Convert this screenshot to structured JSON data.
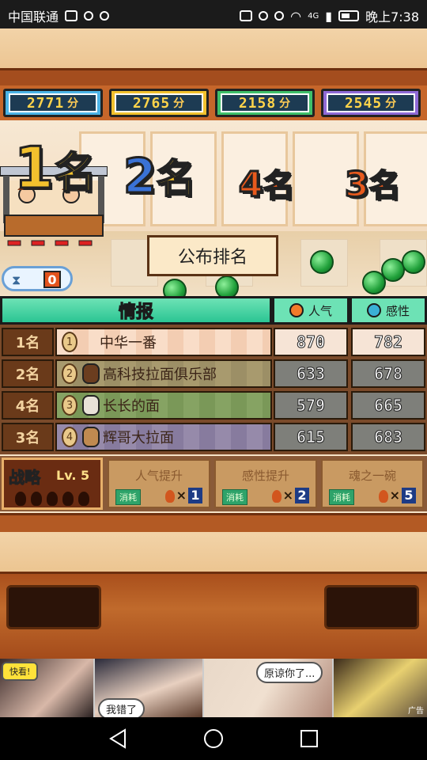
{
  "status_bar": {
    "carrier": "中国联通",
    "time": "晚上7:38",
    "network": "4G"
  },
  "scores": [
    {
      "value": "2771",
      "unit": "分",
      "color": "#4bb3e6"
    },
    {
      "value": "2765",
      "unit": "分",
      "color": "#f2c12e"
    },
    {
      "value": "2158",
      "unit": "分",
      "color": "#3fc06a"
    },
    {
      "value": "2545",
      "unit": "分",
      "color": "#8f6ad6"
    }
  ],
  "ranks": [
    {
      "num": "1",
      "kanji": "名",
      "color": "#f2c12e"
    },
    {
      "num": "2",
      "kanji": "名",
      "color": "#3a72d6"
    },
    {
      "num": "4",
      "kanji": "名",
      "color": "#e85a1d"
    },
    {
      "num": "3",
      "kanji": "名",
      "color": "#e85a1d"
    }
  ],
  "announce_button": "公布排名",
  "timer_value": "0",
  "info_table": {
    "title": "情报",
    "col_popularity": "人气",
    "col_sensitivity": "感性",
    "rows": [
      {
        "rank": "1名",
        "badge": "1",
        "name": "中华一番",
        "popularity": "870",
        "sensitivity": "782",
        "bg": "#f7d2b8"
      },
      {
        "rank": "2名",
        "badge": "2",
        "name": "高科技拉面俱乐部",
        "popularity": "633",
        "sensitivity": "678",
        "bg": "#a3976d"
      },
      {
        "rank": "4名",
        "badge": "3",
        "name": "长长的面",
        "popularity": "579",
        "sensitivity": "665",
        "bg": "#7f9d5d"
      },
      {
        "rank": "3名",
        "badge": "4",
        "name": "辉哥大拉面",
        "popularity": "615",
        "sensitivity": "683",
        "bg": "#8f82a6"
      }
    ]
  },
  "strategy": {
    "title": "战略",
    "level_label": "Lv.",
    "level": "5",
    "cards": [
      {
        "label": "人气提升",
        "tag": "消耗",
        "count": "1"
      },
      {
        "label": "感性提升",
        "tag": "消耗",
        "count": "2"
      },
      {
        "label": "魂之一碗",
        "tag": "消耗",
        "count": "5"
      }
    ]
  },
  "ad": {
    "panels": [
      {
        "label": "快看!"
      },
      {
        "bubble": "我错了"
      },
      {
        "bubble": "原谅你了..."
      },
      {
        "tag": "广告"
      }
    ]
  }
}
